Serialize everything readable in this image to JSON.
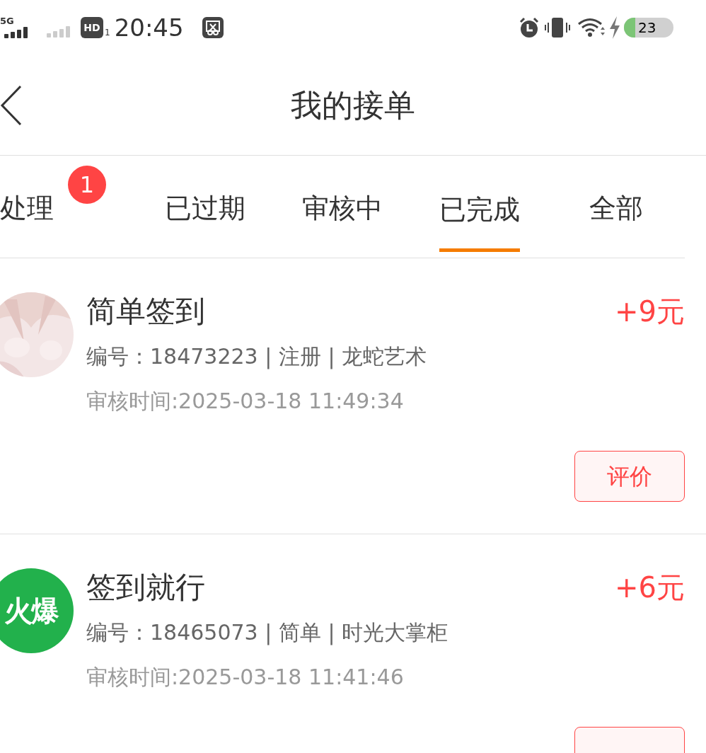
{
  "status_bar": {
    "network": "5G",
    "hd": "HD",
    "sim": "1",
    "time": "20:45",
    "battery": "23",
    "level": 0.23
  },
  "header": {
    "title": "我的接单"
  },
  "tabs": [
    {
      "label": "处理",
      "selected": false,
      "badge": "1"
    },
    {
      "label": "已过期",
      "selected": false
    },
    {
      "label": "审核中",
      "selected": false
    },
    {
      "label": "已完成",
      "selected": true
    },
    {
      "label": "全部",
      "selected": false
    }
  ],
  "orders": [
    {
      "title": "简单签到",
      "reward": "+9元",
      "meta": "编号：18473223 | 注册 | 龙蛇艺术",
      "time": "审核时间:2025-03-18 11:49:34",
      "action": "评价"
    },
    {
      "avatar": {
        "kind": "text",
        "text": "火爆",
        "color": "#22b14c"
      },
      "title": "签到就行",
      "reward": "+6元",
      "meta": "编号：18465073 | 简单 | 时光大掌柜",
      "time": "审核时间:2025-03-18 11:41:46"
    }
  ]
}
